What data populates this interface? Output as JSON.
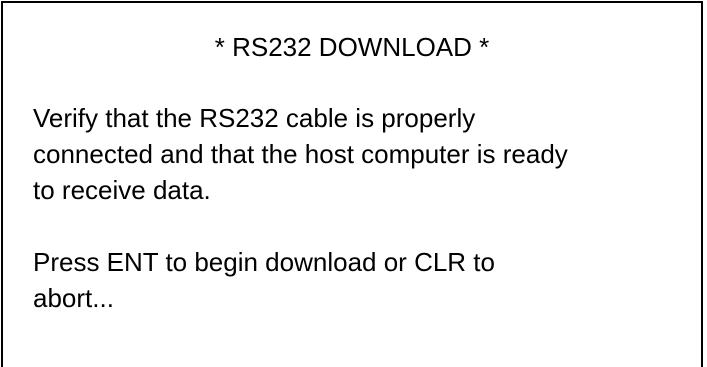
{
  "screen": {
    "title": "* RS232 DOWNLOAD *",
    "message_lines": [
      "Verify that the RS232 cable is properly",
      "connected and that the host computer is ready",
      "to receive data."
    ],
    "prompt_lines": [
      "Press ENT to begin download or CLR to",
      "abort..."
    ]
  }
}
